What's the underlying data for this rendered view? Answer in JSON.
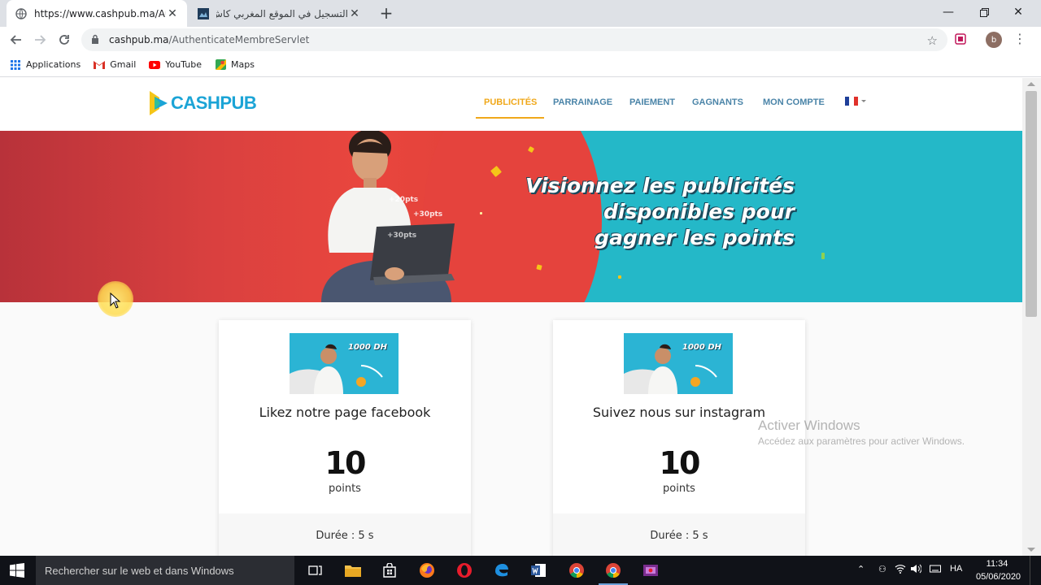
{
  "browser": {
    "tabs": [
      {
        "title": "https://www.cashpub.ma/Authen",
        "active": true
      },
      {
        "title": "التسجيل في الموقع المغربي كاش",
        "active": false
      }
    ],
    "url_host": "cashpub.ma",
    "url_path": "/AuthenticateMembreServlet",
    "profile_initial": "b",
    "bookmarks": [
      "Applications",
      "Gmail",
      "YouTube",
      "Maps"
    ]
  },
  "site": {
    "logo_text": "CASHPUB",
    "nav": [
      {
        "label": "PUBLICITÉS",
        "active": true
      },
      {
        "label": "PARRAINAGE",
        "active": false
      },
      {
        "label": "PAIEMENT",
        "active": false
      },
      {
        "label": "GAGNANTS",
        "active": false
      },
      {
        "label": "MON COMPTE",
        "active": false
      }
    ],
    "banner_lines": [
      "Visionnez les publicités",
      "disponibles pour",
      "gagner les points"
    ],
    "banner_tags": [
      "+20pts",
      "+30pts",
      "+30pts"
    ],
    "cards": [
      {
        "thumb_text": "1000 DH",
        "title": "Likez notre page facebook",
        "points": "10",
        "points_unit": "points",
        "duration": "Durée : 5 s"
      },
      {
        "thumb_text": "1000 DH",
        "title": "Suivez nous sur instagram",
        "points": "10",
        "points_unit": "points",
        "duration": "Durée : 5 s"
      }
    ]
  },
  "windows_watermark": {
    "title": "Activer Windows",
    "subtitle": "Accédez aux paramètres pour activer Windows."
  },
  "taskbar": {
    "search_placeholder": "Rechercher sur le web et dans Windows",
    "language": "HA",
    "time": "11:34",
    "date": "05/06/2020"
  },
  "colors": {
    "accent": "#f0a81a",
    "nav_link": "#4a84a8",
    "logo_blue": "#1ba4d6",
    "banner_red": "#e5433d",
    "banner_cyan": "#24b8c8"
  }
}
